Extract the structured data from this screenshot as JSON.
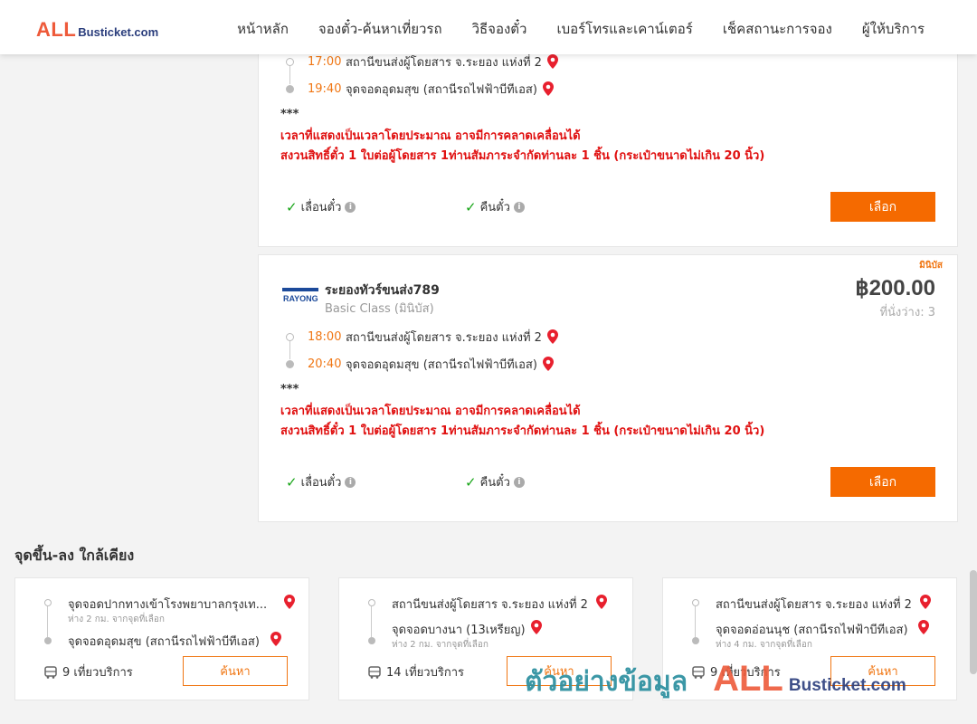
{
  "header": {
    "logo_all": "ALL",
    "logo_rest": "Busticket.com",
    "nav": [
      "หน้าหลัก",
      "จองตั๋ว-ค้นหาเที่ยวรถ",
      "วิธีจองตั๋ว",
      "เบอร์โทรและเคาน์เตอร์",
      "เช็คสถานะการจอง",
      "ผู้ให้บริการ"
    ]
  },
  "trip1": {
    "departure_time": "17:00",
    "departure_place": "สถานีขนส่งผู้โดยสาร จ.ระยอง แห่งที่ 2",
    "arrival_time": "19:40",
    "arrival_place": "จุดจอดอุดมสุข (สถานีรถไฟฟ้าบีทีเอส)",
    "note_stars": "***",
    "note1": "เวลาที่แสดงเป็นเวลาโดยประมาณ อาจมีการคลาดเคลื่อนได้",
    "note2": "สงวนสิทธิ์ตั๋ว 1 ใบต่อผู้โดยสาร 1ท่านสัมภาระจำกัดท่านละ 1 ชิ้น (กระเป๋าขนาดไม่เกิน 20 นิ้ว)",
    "option_postpone": "เลื่อนตั๋ว",
    "option_refund": "คืนตั๋ว",
    "select_label": "เลือก"
  },
  "trip2": {
    "badge": "มินิบัส",
    "operator_logo_text": "RAYONG",
    "operator_name": "ระยองทัวร์ขนส่ง789",
    "class": "Basic Class (มินิบัส)",
    "price": "฿200.00",
    "seats": "ที่นั่งว่าง: 3",
    "departure_time": "18:00",
    "departure_place": "สถานีขนส่งผู้โดยสาร จ.ระยอง แห่งที่ 2",
    "arrival_time": "20:40",
    "arrival_place": "จุดจอดอุดมสุข (สถานีรถไฟฟ้าบีทีเอส)",
    "note_stars": "***",
    "note1": "เวลาที่แสดงเป็นเวลาโดยประมาณ อาจมีการคลาดเคลื่อนได้",
    "note2": "สงวนสิทธิ์ตั๋ว 1 ใบต่อผู้โดยสาร 1ท่านสัมภาระจำกัดท่านละ 1 ชิ้น (กระเป๋าขนาดไม่เกิน 20 นิ้ว)",
    "option_postpone": "เลื่อนตั๋ว",
    "option_refund": "คืนตั๋ว",
    "select_label": "เลือก"
  },
  "nearby": {
    "title": "จุดขึ้น-ลง ใกล้เคียง",
    "cards": [
      {
        "from": "จุดจอดปากทางเข้าโรงพยาบาลกรุงเท...",
        "from_sub": "ห่าง 2 กม. จากจุดที่เลือก",
        "to": "จุดจอดอุดมสุข (สถานีรถไฟฟ้าบีทีเอส)",
        "to_sub": "",
        "trips": "9 เที่ยวบริการ",
        "search_label": "ค้นหา"
      },
      {
        "from": "สถานีขนส่งผู้โดยสาร จ.ระยอง แห่งที่ 2",
        "from_sub": "",
        "to": "จุดจอดบางนา (13เหรียญ)",
        "to_sub": "ห่าง 2 กม. จากจุดที่เลือก",
        "trips": "14 เที่ยวบริการ",
        "search_label": "ค้นหา"
      },
      {
        "from": "สถานีขนส่งผู้โดยสาร จ.ระยอง แห่งที่ 2",
        "from_sub": "",
        "to": "จุดจอดอ่อนนุช (สถานีรถไฟฟ้าบีทีเอส)",
        "to_sub": "ห่าง 4 กม. จากจุดที่เลือก",
        "trips": "9 เที่ยวบริการ",
        "search_label": "ค้นหา"
      }
    ]
  },
  "watermark": {
    "thai": "ตัวอย่างข้อมูล",
    "all": "ALL",
    "rest": "Busticket.com"
  },
  "colors": {
    "accent": "#f56a00",
    "time": "#f07613",
    "warning": "#e01010",
    "check": "#18a518"
  },
  "icons": {
    "pin": "map-pin-icon",
    "check": "check-icon",
    "info": "info-icon",
    "bus": "bus-icon"
  }
}
